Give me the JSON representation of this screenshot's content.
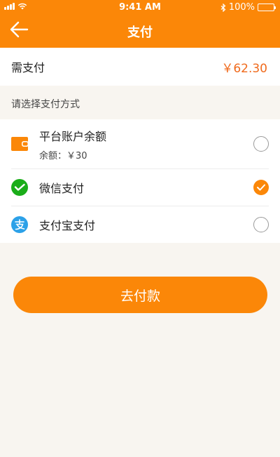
{
  "status_bar": {
    "time": "9:41 AM",
    "battery": "100%"
  },
  "header": {
    "title": "支付",
    "back_icon": "arrow-left-icon"
  },
  "amount": {
    "label": "需支付",
    "value": "￥62.30"
  },
  "section_title": "请选择支付方式",
  "methods": [
    {
      "name": "平台账户余额",
      "sub": "余额：￥30",
      "icon": "wallet-icon",
      "selected": false
    },
    {
      "name": "微信支付",
      "icon": "wechat-pay-icon",
      "selected": true
    },
    {
      "name": "支付宝支付",
      "icon": "alipay-icon",
      "selected": false
    }
  ],
  "pay_button": "去付款",
  "colors": {
    "brand_orange": "#fb8708",
    "price_orange": "#f06a1c",
    "wechat_green": "#1aad19",
    "alipay_blue": "#2ca1e8",
    "background": "#f8f5f0"
  }
}
